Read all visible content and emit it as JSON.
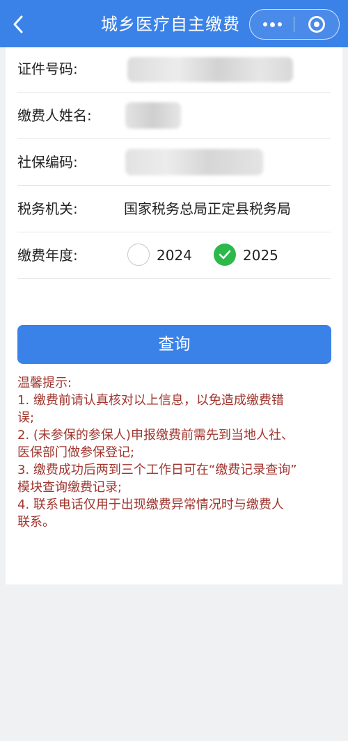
{
  "header": {
    "title": "城乡医疗自主缴费"
  },
  "form": {
    "id_label": "证件号码:",
    "payer_label": "缴费人姓名:",
    "ss_label": "社保编码:",
    "tax_label": "税务机关:",
    "tax_value": "国家税务总局正定县税务局",
    "year_label": "缴费年度:",
    "years": [
      {
        "label": "2024",
        "selected": false
      },
      {
        "label": "2025",
        "selected": true
      }
    ]
  },
  "query_button": "查询",
  "tips": {
    "title": "温馨提示:",
    "lines": [
      "1. 缴费前请认真核对以上信息，以免造成缴费错",
      "误;",
      "2. (未参保的参保人)申报缴费前需先到当地人社、",
      "医保部门做参保登记;",
      "3. 缴费成功后两到三个工作日可在“缴费记录查询”",
      "模块查询缴费记录;",
      "4. 联系电话仅用于出现缴费异常情况时与缴费人",
      "联系。"
    ]
  },
  "icons": [
    "back-icon",
    "more-icon",
    "close-icon",
    "check-icon"
  ],
  "colors": {
    "primary": "#3b82e8",
    "tip_text": "#a0362f",
    "check_green": "#2db84b"
  }
}
